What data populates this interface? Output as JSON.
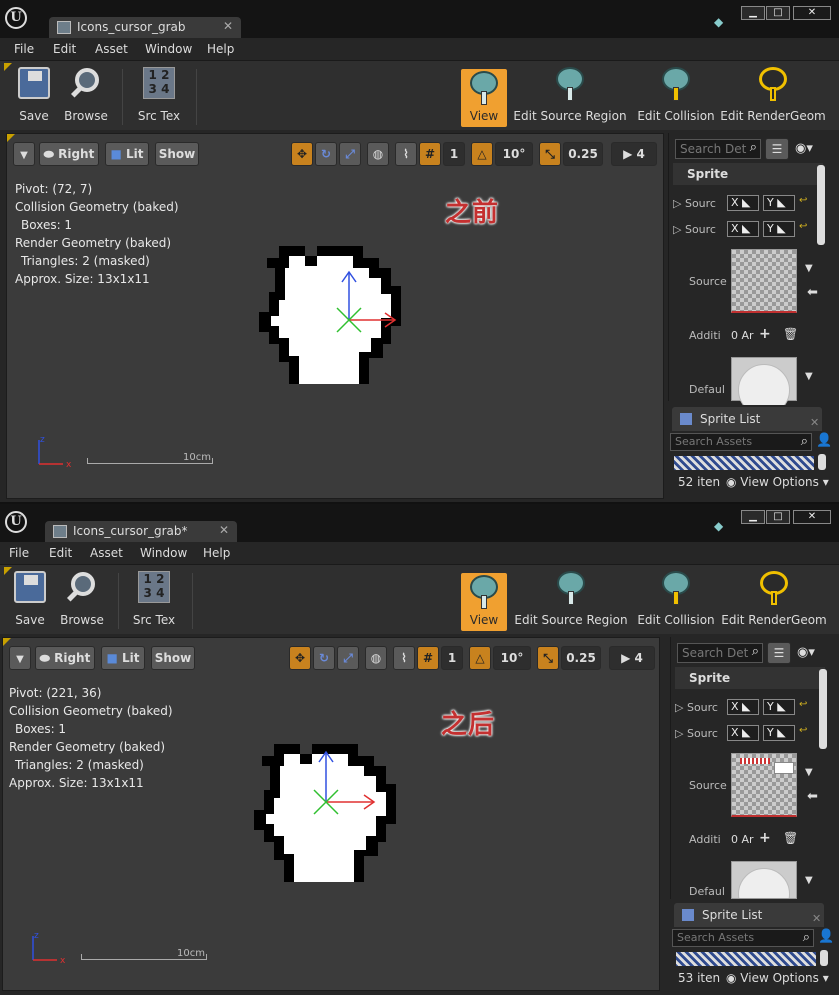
{
  "editors": [
    {
      "tab_title": "Icons_cursor_grab",
      "menu": [
        "File",
        "Edit",
        "Asset",
        "Window",
        "Help"
      ],
      "toolbar": {
        "save": "Save",
        "browse": "Browse",
        "src_tex": "Src Tex",
        "src_tex_glyph": "1 2 3 4",
        "view": "View",
        "edit_source_region": "Edit Source Region",
        "edit_collision": "Edit Collision",
        "edit_render_geom": "Edit RenderGeom"
      },
      "viewport_toolbar": {
        "view_mode": "Right",
        "lit": "Lit",
        "show": "Show",
        "grid_size": "1",
        "rotation_snap": "10°",
        "scale_snap": "0.25",
        "camera_speed": "4"
      },
      "stats": {
        "pivot": "Pivot: (72, 7)",
        "collision": "Collision Geometry (baked)",
        "boxes": "Boxes: 1",
        "render": "Render Geometry (baked)",
        "triangles": "Triangles: 2 (masked)",
        "size": "Approx. Size: 13x1x11"
      },
      "annotation": "之前",
      "scale_label": "10cm",
      "details": {
        "search_placeholder": "Search Det",
        "category": "Sprite",
        "row_source1": "Sourc",
        "row_source2": "Sourc",
        "row_source_tex": "Source",
        "row_additional": "Additi",
        "additional_value": "0 Ar",
        "row_default": "Defaul",
        "x_label": "X",
        "y_label": "Y"
      },
      "sprite_list": {
        "tab": "Sprite List",
        "search_placeholder": "Search Assets",
        "item_count": "52 iten",
        "view_options": "View Options"
      }
    },
    {
      "tab_title": "Icons_cursor_grab*",
      "menu": [
        "File",
        "Edit",
        "Asset",
        "Window",
        "Help"
      ],
      "toolbar": {
        "save": "Save",
        "browse": "Browse",
        "src_tex": "Src Tex",
        "src_tex_glyph": "1 2 3 4",
        "view": "View",
        "edit_source_region": "Edit Source Region",
        "edit_collision": "Edit Collision",
        "edit_render_geom": "Edit RenderGeom"
      },
      "viewport_toolbar": {
        "view_mode": "Right",
        "lit": "Lit",
        "show": "Show",
        "grid_size": "1",
        "rotation_snap": "10°",
        "scale_snap": "0.25",
        "camera_speed": "4"
      },
      "stats": {
        "pivot": "Pivot: (221, 36)",
        "collision": "Collision Geometry (baked)",
        "boxes": "Boxes: 1",
        "render": "Render Geometry (baked)",
        "triangles": "Triangles: 2 (masked)",
        "size": "Approx. Size: 13x1x11"
      },
      "annotation": "之后",
      "scale_label": "10cm",
      "details": {
        "search_placeholder": "Search Det",
        "category": "Sprite",
        "row_source1": "Sourc",
        "row_source2": "Sourc",
        "row_source_tex": "Source",
        "row_additional": "Additi",
        "additional_value": "0 Ar",
        "row_default": "Defaul",
        "x_label": "X",
        "y_label": "Y"
      },
      "sprite_list": {
        "tab": "Sprite List",
        "search_placeholder": "Search Assets",
        "item_count": "53 iten",
        "view_options": "View Options"
      }
    }
  ],
  "colors": {
    "accent_orange": "#f0a030",
    "annotation_red": "#c43030",
    "axis_x": "#e03030",
    "axis_y": "#30c030",
    "axis_z": "#3050e0"
  }
}
